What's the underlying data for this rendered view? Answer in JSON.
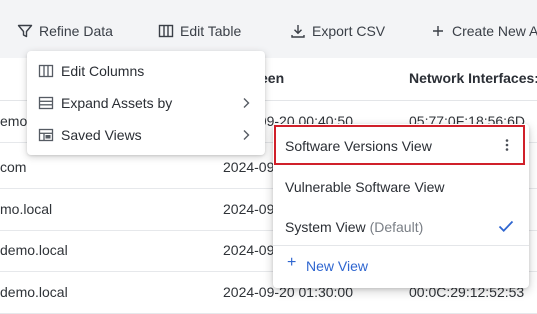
{
  "toolbar": {
    "refine_data": "Refine Data",
    "edit_table": "Edit Table",
    "export_csv": "Export CSV",
    "create_new": "Create New As"
  },
  "table": {
    "headers": [
      "een",
      "Network Interfaces:"
    ],
    "rows": [
      {
        "name": "emo",
        "last_seen": "2024-09-20 00:40:50",
        "network": "05:77:0F:18:56:6D"
      },
      {
        "name": "com",
        "last_seen": "2024-09",
        "network": ""
      },
      {
        "name": "mo.local",
        "last_seen": "2024-09",
        "network": ""
      },
      {
        "name": "demo.local",
        "last_seen": "2024-09",
        "network": ""
      },
      {
        "name": "demo.local",
        "last_seen": "2024-09-20 01:30:00",
        "network": "00:0C:29:12:52:53"
      }
    ]
  },
  "refine_menu": {
    "items": [
      {
        "label": "Edit Columns",
        "icon": "columns-icon"
      },
      {
        "label": "Expand Assets by",
        "icon": "rows-icon"
      },
      {
        "label": "Saved Views",
        "icon": "saved-views-icon"
      }
    ]
  },
  "saved_views": {
    "items": [
      {
        "label": "Software Versions View"
      },
      {
        "label": "Vulnerable Software View"
      },
      {
        "label": "System View",
        "suffix": "(Default)"
      }
    ],
    "new_view": "New View",
    "highlight_color": "#d0202a",
    "accent_color": "#2f66d0"
  }
}
